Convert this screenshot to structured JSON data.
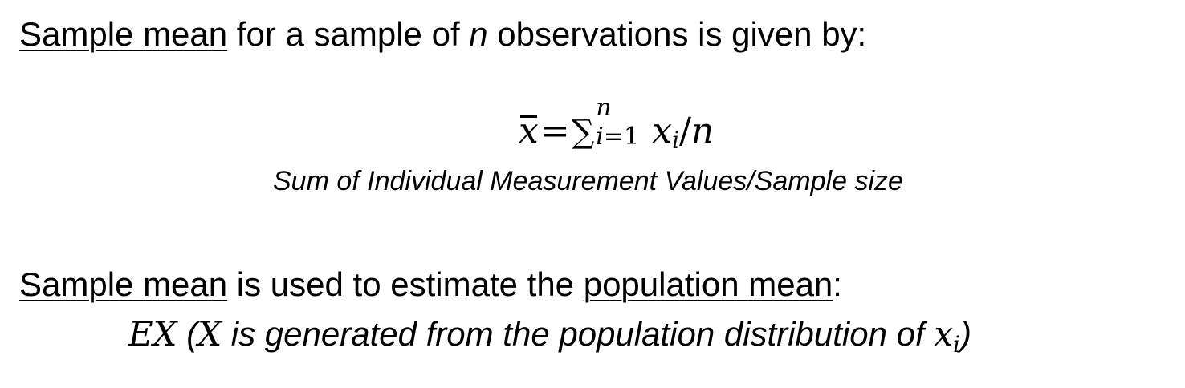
{
  "line1": {
    "term": "Sample mean",
    "text_a": " for a sample of ",
    "var_n": "n",
    "text_b": " observations is given by:"
  },
  "formula": {
    "xbar": "x",
    "equals": "=",
    "sum": "∑",
    "upper": "n",
    "lower_var": "i",
    "lower_rest": "=1",
    "term_x": "x",
    "term_sub": "i",
    "slash": "/",
    "denominator": "n"
  },
  "caption": "Sum of Individual Measurement Values/Sample size",
  "line3": {
    "term": "Sample mean",
    "text_a": " is used to estimate the ",
    "term2": "population mean",
    "text_b": ":"
  },
  "line4": {
    "ex": "EX",
    "open": " (",
    "x_var": "X",
    "text": " is generated from the population distribution of ",
    "xi": "x",
    "xi_sub": "i",
    "close": ")"
  }
}
